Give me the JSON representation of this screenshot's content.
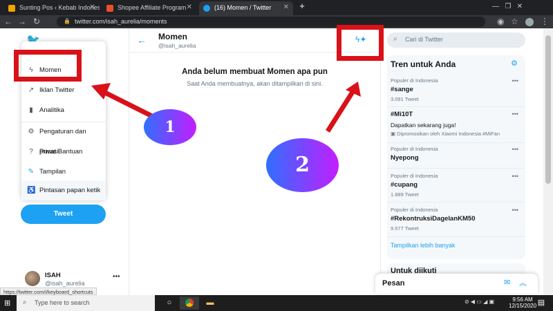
{
  "browser": {
    "tabs": [
      {
        "title": "Sunting Pos ‹ Kebab Indonesia"
      },
      {
        "title": "Shopee Affiliate Program"
      },
      {
        "title": "(16) Momen / Twitter"
      }
    ],
    "new_tab_label": "+",
    "url": "twitter.com/isah_aurelia/moments",
    "icons": {
      "back": "arrow-left-icon",
      "forward": "arrow-right-icon",
      "reload": "reload-icon",
      "star": "star-icon"
    }
  },
  "sidebar": {
    "menu": [
      {
        "label": "Momen",
        "icon": "bolt-icon"
      },
      {
        "label": "Iklan Twitter",
        "icon": "external-link-icon"
      },
      {
        "label": "Analitika",
        "icon": "bar-chart-icon"
      },
      {
        "label": "Pengaturan dan privasi",
        "icon": "gear-icon"
      },
      {
        "label": "Pusat Bantuan",
        "icon": "question-icon"
      },
      {
        "label": "Tampilan",
        "icon": "edit-icon"
      },
      {
        "label": "Pintasan papan ketik",
        "icon": "accessibility-icon"
      }
    ],
    "tweet_button": "Tweet",
    "account": {
      "name": "ISAH",
      "handle": "@isah_aurelia",
      "more": "•••"
    }
  },
  "main": {
    "title": "Momen",
    "handle": "@isah_aurelia",
    "empty_title": "Anda belum membuat Momen apa pun",
    "empty_subtitle": "Saat Anda membuatnya, akan ditampilkan di sini."
  },
  "right": {
    "search_placeholder": "Cari di Twitter",
    "trends_title": "Tren untuk Anda",
    "trends": [
      {
        "context": "Populer di Indonesia",
        "name": "#sange",
        "count": "3.091 Tweet"
      },
      {
        "context": "",
        "name": "#Mi10T",
        "desc": "Dapatkan sekarang juga!",
        "promo": "Dipromosikan oleh Xiaomi Indonesia #MiFan"
      },
      {
        "context": "Populer di Indonesia",
        "name": "Nyepong",
        "count": ""
      },
      {
        "context": "Populer di Indonesia",
        "name": "#cupang",
        "count": "1.889 Tweet"
      },
      {
        "context": "Populer di Indonesia",
        "name": "#RekontruksiDagelanKM50",
        "count": "9.577 Tweet"
      }
    ],
    "show_more": "Tampilkan lebih banyak",
    "who_to_follow": "Untuk diikuti",
    "messages_title": "Pesan"
  },
  "status_url": "https://twitter.com/i/keyboard_shortcuts",
  "taskbar": {
    "search_placeholder": "Type here to search",
    "time": "9:56 AM",
    "date": "12/15/2020"
  },
  "annotations": {
    "step1": "1",
    "step2": "2"
  },
  "colors": {
    "accent": "#1da1f2",
    "annotation_red": "#d91118"
  }
}
